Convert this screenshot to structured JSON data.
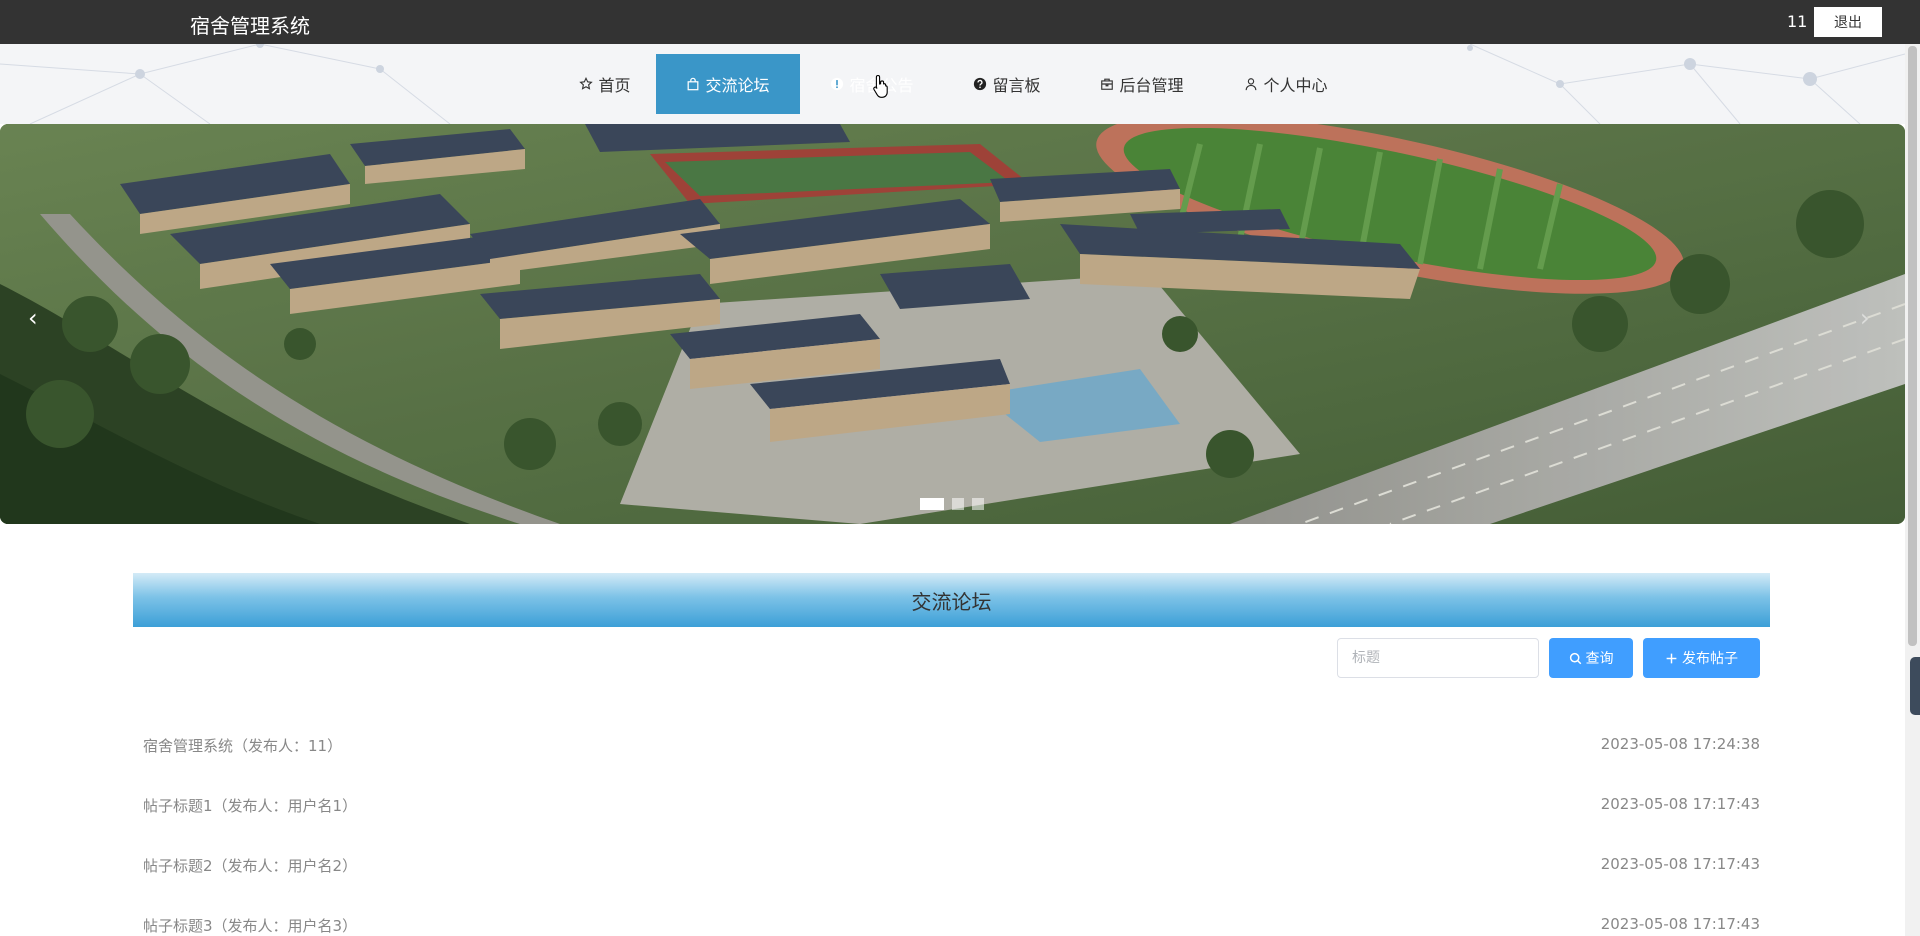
{
  "app": {
    "title": "宿舍管理系统",
    "username": "11",
    "logout_label": "退出"
  },
  "nav": {
    "items": [
      {
        "label": "首页",
        "icon": "star-icon",
        "active": false
      },
      {
        "label": "交流论坛",
        "icon": "bag-icon",
        "active": true
      },
      {
        "label": "宿舍公告",
        "icon": "exclamation-circle-icon",
        "active": false
      },
      {
        "label": "留言板",
        "icon": "question-circle-icon",
        "active": false
      },
      {
        "label": "后台管理",
        "icon": "box-icon",
        "active": false
      },
      {
        "label": "个人中心",
        "icon": "user-icon",
        "active": false
      }
    ]
  },
  "banner": {
    "prev": "‹",
    "next": "›",
    "slide_count": 3,
    "active_slide": 1
  },
  "forum": {
    "title": "交流论坛",
    "search_placeholder": "标题",
    "search_value": "",
    "query_label": "查询",
    "post_label": "发布帖子",
    "posts": [
      {
        "title": "宿舍管理系统（发布人：11）",
        "date": "2023-05-08 17:24:38"
      },
      {
        "title": "帖子标题1（发布人：用户名1）",
        "date": "2023-05-08 17:17:43"
      },
      {
        "title": "帖子标题2（发布人：用户名2）",
        "date": "2023-05-08 17:17:43"
      },
      {
        "title": "帖子标题3（发布人：用户名3）",
        "date": "2023-05-08 17:17:43"
      }
    ]
  },
  "colors": {
    "topbar": "#333333",
    "nav_active": "#3a96c8",
    "primary_button": "#409eff"
  }
}
